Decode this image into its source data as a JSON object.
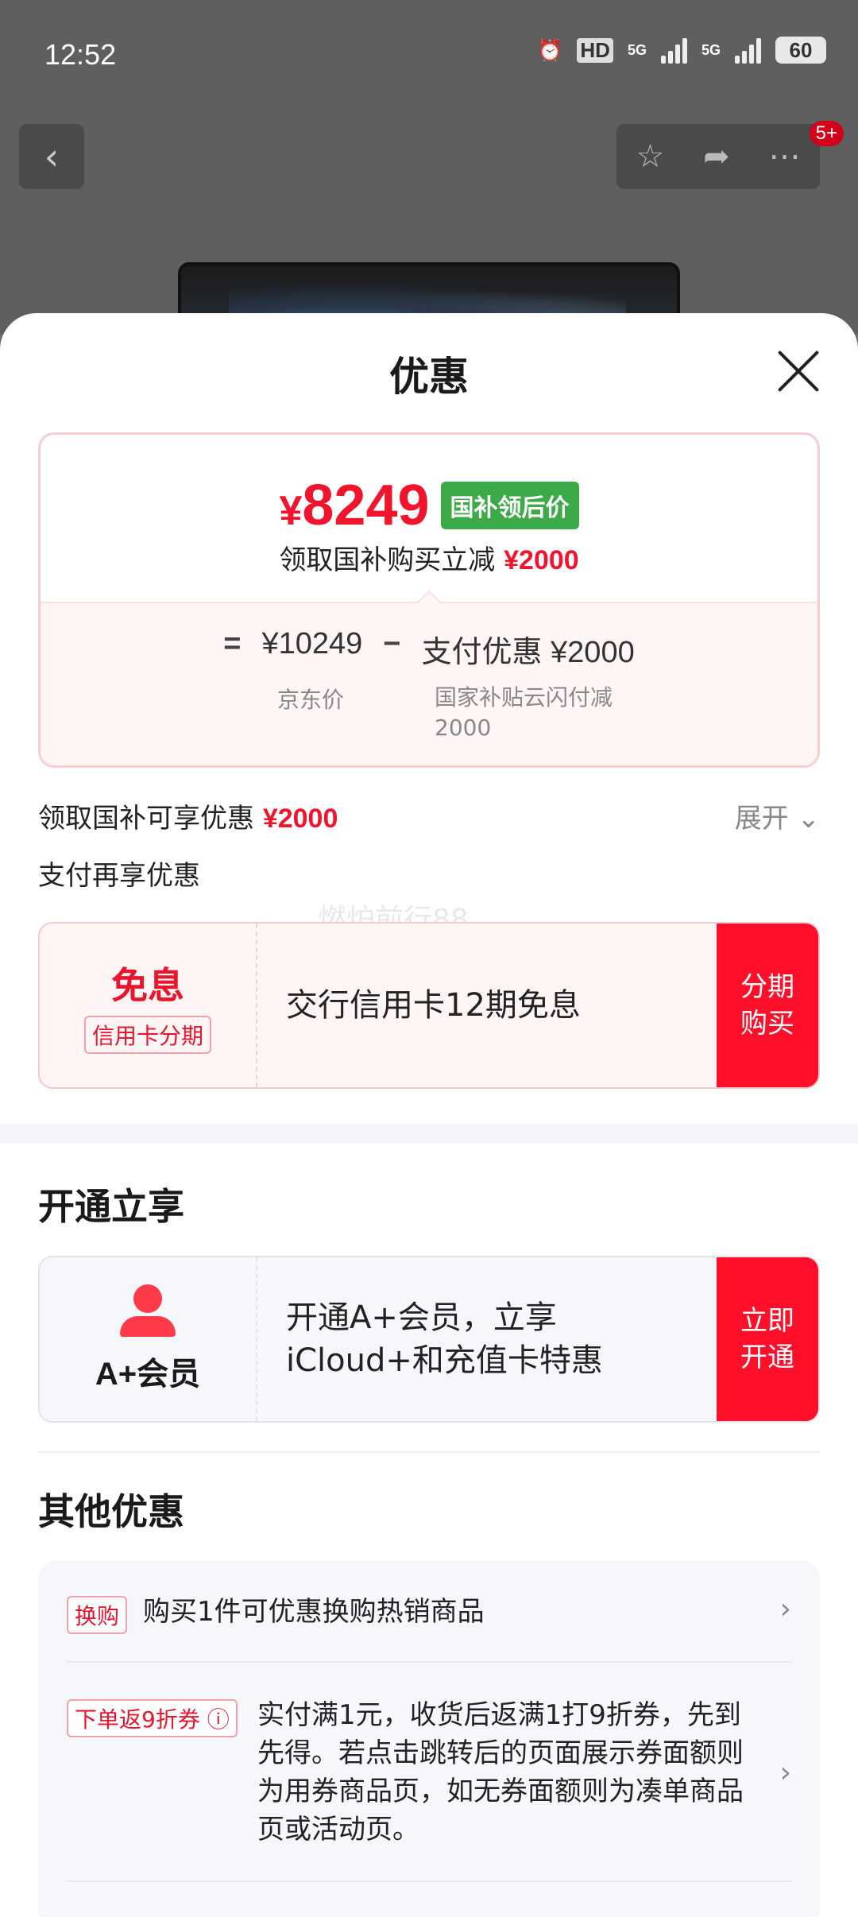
{
  "status_bar": {
    "time": "12:52",
    "battery": "60",
    "net1": "5G",
    "net2": "5G",
    "hd": "HD"
  },
  "nav": {
    "back_glyph": "‹",
    "badge": "5+"
  },
  "sheet": {
    "title": "优惠",
    "price_card": {
      "yen": "¥",
      "final_price": "8249",
      "tag": "国补领后价",
      "sub_text": "领取国补购买立减",
      "sub_amount": "¥2000",
      "eq": "=",
      "jd_price": "¥10249",
      "minus": "−",
      "discount_text": "支付优惠 ¥2000",
      "jd_label": "京东价",
      "discount_label": "国家补贴云闪付减2000"
    },
    "subsidy_row": {
      "text": "领取国补可享优惠",
      "amount": "¥2000",
      "expand": "展开"
    },
    "pay_row": {
      "text": "支付再享优惠"
    },
    "watermark": "燃炉前行88",
    "installment": {
      "big": "免息",
      "tag": "信用卡分期",
      "desc": "交行信用卡12期免息",
      "button": "分期\n购买"
    },
    "open_section": {
      "title": "开通立享",
      "member_label": "A+会员",
      "desc": "开通A+会员，立享iCloud+和充值卡特惠",
      "button": "立即\n开通"
    },
    "other_section": {
      "title": "其他优惠",
      "items": [
        {
          "tag": "换购",
          "text": "购买1件可优惠换购热销商品",
          "arrow": "›"
        },
        {
          "tag": "下单返9折券 ⓘ",
          "text": "实付满1元，收货后返满1打9折券，先到先得。若点击跳转后的页面展示券面额则为用券商品页，如无券面额则为凑单商品页或活动页。",
          "arrow": "›"
        }
      ]
    }
  }
}
